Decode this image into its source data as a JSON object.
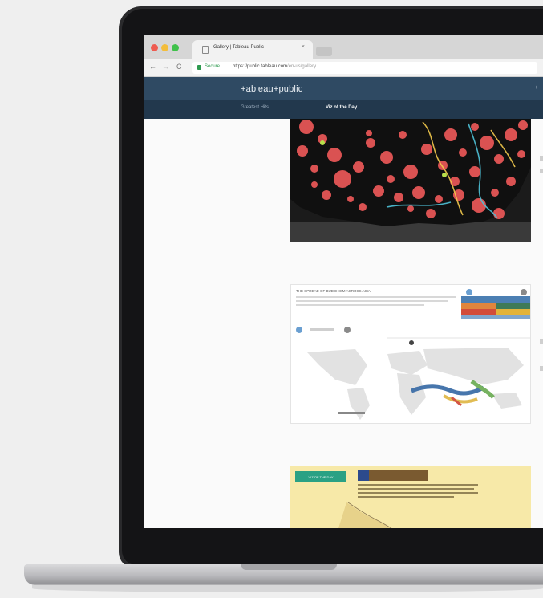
{
  "browser": {
    "tab_title": "Gallery | Tableau Public",
    "tab_close": "×",
    "nav_back": "←",
    "nav_forward": "→",
    "nav_reload": "C",
    "secure_label": "Secure",
    "url_host": "https://public.tableau.com",
    "url_path": "/en-us/gallery"
  },
  "site": {
    "logo": "+ableau+public",
    "nav": [
      {
        "label": "Greatest Hits"
      },
      {
        "label": "Viz of the Day"
      }
    ],
    "header_right_glyph": "+"
  },
  "gallery": {
    "card2_title": "THE SPREAD OF BUDDHISM ACROSS ASIA",
    "card3_button": "VIZ OF THE DAY"
  },
  "colors": {
    "header": "#2f4a63",
    "nav": "#22384d",
    "map_dot": "#e55656",
    "map_bg": "#1b1b1b",
    "accent_green": "#2aa184"
  }
}
